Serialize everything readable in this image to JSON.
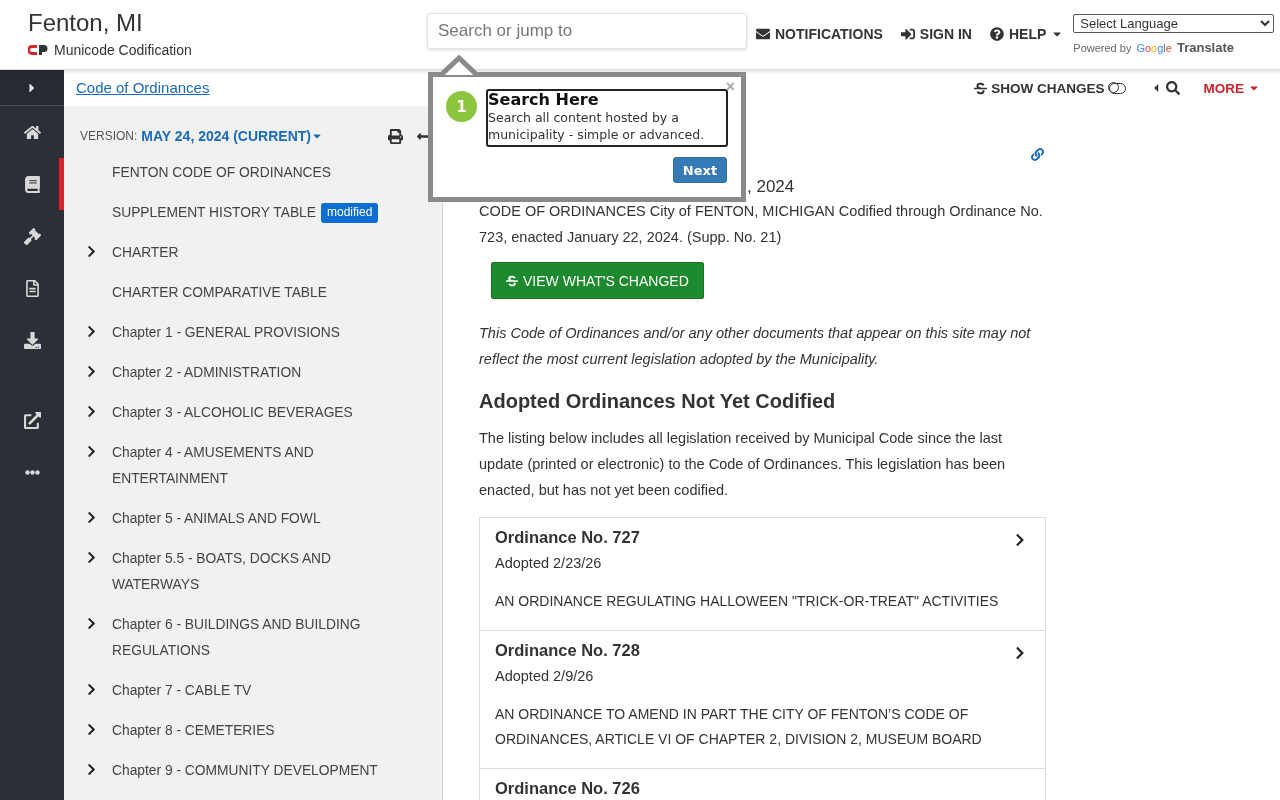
{
  "header": {
    "city": "Fenton, MI",
    "brand": "Municode Codification",
    "search": {
      "placeholder": "Search or jump to"
    },
    "nav": [
      {
        "kind": "mail",
        "label": "NOTIFICATIONS",
        "caret": false
      },
      {
        "kind": "signin",
        "label": "SIGN IN",
        "caret": false
      },
      {
        "kind": "help",
        "label": "HELP",
        "caret": true
      }
    ],
    "language": {
      "select": "Select Language",
      "powered_by": "Powered by",
      "google": "Google",
      "translate": "Translate"
    }
  },
  "rail": {
    "items": [
      {
        "kind": "home",
        "selected": false
      },
      {
        "kind": "book",
        "selected": true
      },
      {
        "kind": "gavel",
        "selected": false
      },
      {
        "kind": "document",
        "selected": false
      },
      {
        "kind": "download",
        "selected": false
      }
    ],
    "extra_items": [
      {
        "kind": "external",
        "selected": false
      },
      {
        "kind": "more",
        "selected": false
      }
    ]
  },
  "breadcrumb": "Code of Ordinances",
  "version": {
    "label": "VERSION:",
    "value": "MAY 24, 2024 (CURRENT)"
  },
  "toc": [
    {
      "label": "FENTON CODE OF ORDINANCES",
      "expandable": false
    },
    {
      "label": "SUPPLEMENT HISTORY TABLE",
      "expandable": false,
      "badge": "modified"
    },
    {
      "label": "CHARTER",
      "expandable": true
    },
    {
      "label": "CHARTER COMPARATIVE TABLE",
      "expandable": false
    },
    {
      "label": "Chapter 1 - GENERAL PROVISIONS",
      "expandable": true
    },
    {
      "label": "Chapter 2 - ADMINISTRATION",
      "expandable": true
    },
    {
      "label": "Chapter 3 - ALCOHOLIC BEVERAGES",
      "expandable": true
    },
    {
      "label": "Chapter 4 - AMUSEMENTS AND ENTERTAINMENT",
      "expandable": true
    },
    {
      "label": "Chapter 5 - ANIMALS AND FOWL",
      "expandable": true
    },
    {
      "label": "Chapter 5.5 - BOATS, DOCKS AND WATERWAYS",
      "expandable": true
    },
    {
      "label": "Chapter 6 - BUILDINGS AND BUILDING REGULATIONS",
      "expandable": true
    },
    {
      "label": "Chapter 7 - CABLE TV",
      "expandable": true
    },
    {
      "label": "Chapter 8 - CEMETERIES",
      "expandable": true
    },
    {
      "label": "Chapter 9 - COMMUNITY DEVELOPMENT",
      "expandable": true
    }
  ],
  "toolbar": {
    "show_changes": {
      "label": "SHOW CHANGES",
      "on": false
    },
    "more": "MORE"
  },
  "document": {
    "updated": ", 2024",
    "intro": "CODE OF ORDINANCES City of FENTON, MICHIGAN Codified through Ordinance No. 723, enacted January 22, 2024. (Supp. No. 21)",
    "button": "VIEW WHAT'S CHANGED",
    "disclaimer": "This Code of Ordinances and/or any other documents that appear on this site may not reflect the most current legislation adopted by the Municipality.",
    "section_title": "Adopted Ordinances Not Yet Codified",
    "section_text": "The listing below includes all legislation received by Municipal Code since the last update (printed or electronic) to the Code of Ordinances. This legislation has been enacted, but has not yet been codified.",
    "ordinances": [
      {
        "title": "Ordinance No. 727",
        "adopted": "Adopted 2/23/26",
        "description": "AN ORDINANCE REGULATING HALLOWEEN \"TRICK-OR-TREAT\" ACTIVITIES"
      },
      {
        "title": "Ordinance No. 728",
        "adopted": "Adopted 2/9/26",
        "description": "AN ORDINANCE TO AMEND IN PART THE CITY OF FENTON’S CODE OF ORDINANCES, ARTICLE VI OF CHAPTER 2, DIVISION 2, MUSEUM BOARD"
      },
      {
        "title": "Ordinance No. 726"
      }
    ]
  },
  "tour": {
    "step": "1",
    "title": "Search Here",
    "text": "Search all content hosted by a municipality - simple or advanced.",
    "next": "Next",
    "close": "×"
  }
}
